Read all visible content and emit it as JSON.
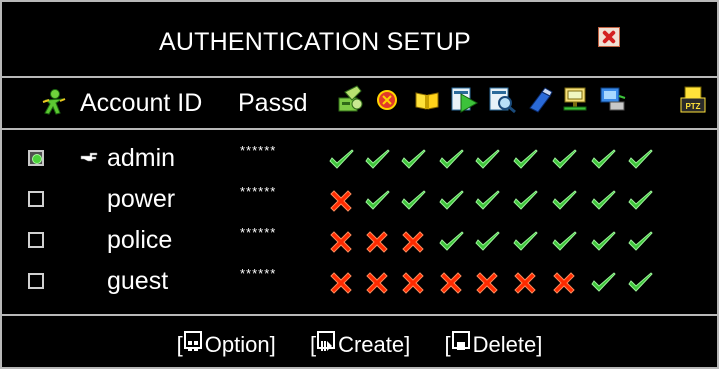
{
  "window": {
    "title": "AUTHENTICATION SETUP",
    "close_icon": "close-icon"
  },
  "header": {
    "account_id": "Account ID",
    "password": "Passd"
  },
  "columns": [
    "user-icon",
    "settings-icon",
    "record-icon",
    "search-icon",
    "playback-icon",
    "view-icon",
    "backup-icon",
    "network-icon",
    "remote-icon",
    "ptz-icon"
  ],
  "accounts": [
    {
      "name": "admin",
      "password": "******",
      "selected": true,
      "perms": [
        1,
        1,
        1,
        1,
        1,
        1,
        1,
        1,
        1
      ]
    },
    {
      "name": "power",
      "password": "******",
      "selected": false,
      "perms": [
        0,
        1,
        1,
        1,
        1,
        1,
        1,
        1,
        1
      ]
    },
    {
      "name": "police",
      "password": "******",
      "selected": false,
      "perms": [
        0,
        0,
        0,
        1,
        1,
        1,
        1,
        1,
        1
      ]
    },
    {
      "name": "guest",
      "password": "******",
      "selected": false,
      "perms": [
        0,
        0,
        0,
        0,
        0,
        0,
        0,
        1,
        1
      ]
    }
  ],
  "footer": {
    "option": "Option",
    "create": "Create",
    "delete": "Delete"
  },
  "colors": {
    "check": "#3ec43a",
    "cross": "#ff2a00",
    "accent": "#c8c8c8"
  }
}
